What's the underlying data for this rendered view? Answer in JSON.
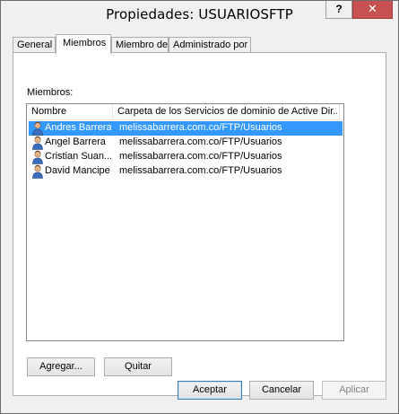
{
  "window": {
    "title": "Propiedades: USUARIOSFTP",
    "help_label": "?",
    "close_label": "✕"
  },
  "tabs": [
    {
      "label": "General",
      "active": false
    },
    {
      "label": "Miembros",
      "active": true
    },
    {
      "label": "Miembro de",
      "active": false
    },
    {
      "label": "Administrado por",
      "active": false
    }
  ],
  "members": {
    "label": "Miembros:",
    "columns": {
      "name": "Nombre",
      "folder": "Carpeta de los Servicios de dominio de Active Dir..."
    },
    "rows": [
      {
        "name": "Andres Barrera",
        "folder": "melissabarrera.com.co/FTP/Usuarios",
        "selected": true
      },
      {
        "name": "Angel Barrera",
        "folder": "melissabarrera.com.co/FTP/Usuarios",
        "selected": false
      },
      {
        "name": "Cristian Suan...",
        "folder": "melissabarrera.com.co/FTP/Usuarios",
        "selected": false
      },
      {
        "name": "David Mancipe",
        "folder": "melissabarrera.com.co/FTP/Usuarios",
        "selected": false
      }
    ],
    "icon": "user-icon"
  },
  "buttons": {
    "add": "Agregar...",
    "remove": "Quitar",
    "ok": "Aceptar",
    "cancel": "Cancelar",
    "apply": "Aplicar"
  },
  "colors": {
    "selection": "#3399ff",
    "close_button": "#c75050"
  }
}
